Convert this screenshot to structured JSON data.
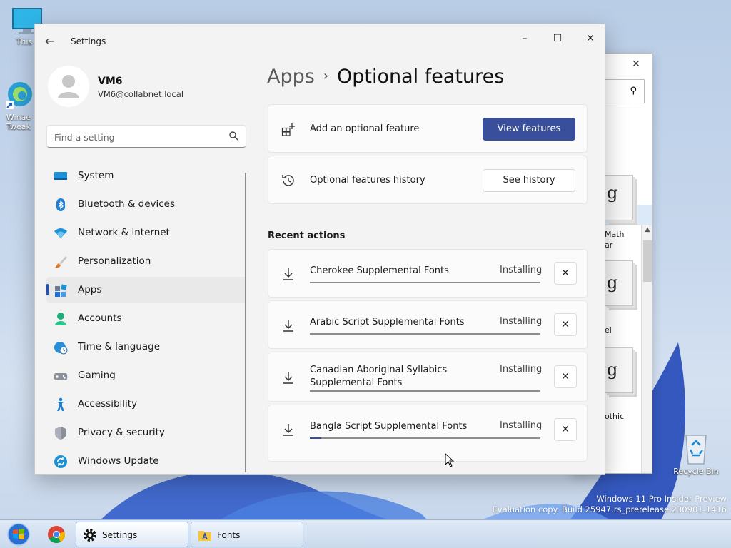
{
  "desktop": {
    "icons": [
      {
        "label": "This P",
        "icon": "monitor-icon"
      },
      {
        "label": "Winae Tweak",
        "icon": "edge-shortcut-icon"
      },
      {
        "label": "Recycle Bin",
        "icon": "recycle-bin-icon"
      }
    ],
    "watermark": {
      "line1": "Windows 11 Pro Insider Preview",
      "line2": "Evaluation copy. Build 25947.rs_prerelease.230901-1416"
    }
  },
  "fonts_window": {
    "close_label": "✕",
    "font_captions": [
      "Math",
      "ar",
      "el",
      "othic"
    ],
    "tile_glyph": "g"
  },
  "settings": {
    "title": "Settings",
    "user": {
      "name": "VM6",
      "email": "VM6@collabnet.local"
    },
    "search": {
      "placeholder": "Find a setting"
    },
    "nav": [
      {
        "label": "System",
        "icon": "system-icon"
      },
      {
        "label": "Bluetooth & devices",
        "icon": "bluetooth-icon"
      },
      {
        "label": "Network & internet",
        "icon": "wifi-icon"
      },
      {
        "label": "Personalization",
        "icon": "brush-icon"
      },
      {
        "label": "Apps",
        "icon": "apps-icon",
        "active": true
      },
      {
        "label": "Accounts",
        "icon": "person-icon"
      },
      {
        "label": "Time & language",
        "icon": "globe-clock-icon"
      },
      {
        "label": "Gaming",
        "icon": "gamepad-icon"
      },
      {
        "label": "Accessibility",
        "icon": "accessibility-icon"
      },
      {
        "label": "Privacy & security",
        "icon": "shield-icon"
      },
      {
        "label": "Windows Update",
        "icon": "update-icon"
      }
    ],
    "breadcrumb": {
      "parent": "Apps",
      "separator": "›",
      "current": "Optional features"
    },
    "add_feature": {
      "label": "Add an optional feature",
      "button": "View features"
    },
    "history": {
      "label": "Optional features history",
      "button": "See history"
    },
    "recent_title": "Recent actions",
    "recent_actions": [
      {
        "name": "Cherokee Supplemental Fonts",
        "status": "Installing",
        "progress": 0
      },
      {
        "name": "Arabic Script Supplemental Fonts",
        "status": "Installing",
        "progress": 0
      },
      {
        "name": "Canadian Aboriginal Syllabics Supplemental Fonts",
        "status": "Installing",
        "progress": 0
      },
      {
        "name": "Bangla Script Supplemental Fonts",
        "status": "Installing",
        "progress": 0.05
      }
    ],
    "colors": {
      "accent": "#3a4f9c",
      "active_indicator": "#1d4fbf"
    }
  },
  "taskbar": {
    "items": [
      {
        "label": "Settings",
        "icon": "settings-gear-icon",
        "active": true
      },
      {
        "label": "Fonts",
        "icon": "fonts-folder-icon",
        "active": false
      }
    ]
  }
}
